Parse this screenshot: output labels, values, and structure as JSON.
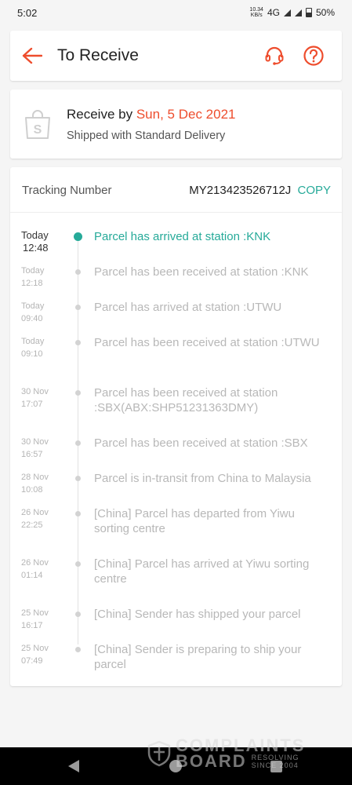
{
  "status_bar": {
    "time": "5:02",
    "net_speed_value": "10.34",
    "net_speed_unit": "KB/s",
    "network": "4G",
    "battery": "50%"
  },
  "header": {
    "title": "To Receive",
    "back_icon": "arrow-left-icon",
    "support_icon": "headset-icon",
    "help_icon": "question-circle-icon"
  },
  "receive": {
    "prefix": "Receive by",
    "date": "Sun, 5 Dec 2021",
    "shipping": "Shipped with Standard Delivery"
  },
  "tracking": {
    "label": "Tracking Number",
    "number": "MY213423526712J",
    "copy_label": "COPY",
    "events": [
      {
        "day": "Today",
        "time": "12:48",
        "message": "Parcel has arrived at station :KNK",
        "active": true
      },
      {
        "day": "Today",
        "time": "12:18",
        "message": "Parcel has been received at station :KNK"
      },
      {
        "day": "Today",
        "time": "09:40",
        "message": "Parcel has arrived at station :UTWU"
      },
      {
        "day": "Today",
        "time": "09:10",
        "message": "Parcel has been received at station :UTWU"
      },
      {
        "day": "30 Nov",
        "time": "17:07",
        "message": "Parcel has been received at station :SBX(ABX:SHP51231363DMY)"
      },
      {
        "day": "30 Nov",
        "time": "16:57",
        "message": "Parcel has been received at station :SBX"
      },
      {
        "day": "28 Nov",
        "time": "10:08",
        "message": "Parcel is in-transit from China to Malaysia"
      },
      {
        "day": "26 Nov",
        "time": "22:25",
        "message": "[China] Parcel has departed from Yiwu sorting centre"
      },
      {
        "day": "26 Nov",
        "time": "01:14",
        "message": "[China] Parcel has arrived at Yiwu sorting centre"
      },
      {
        "day": "25 Nov",
        "time": "16:17",
        "message": "[China] Sender has shipped your parcel"
      },
      {
        "day": "25 Nov",
        "time": "07:49",
        "message": "[China] Sender is preparing to ship your parcel"
      }
    ]
  },
  "watermark": {
    "line1": "COMPLAINTS",
    "line2": "BOARD",
    "tag1": "RESOLVING",
    "tag2": "SINCE 2004"
  },
  "colors": {
    "accent": "#ee4d2d",
    "teal": "#26aa99"
  }
}
